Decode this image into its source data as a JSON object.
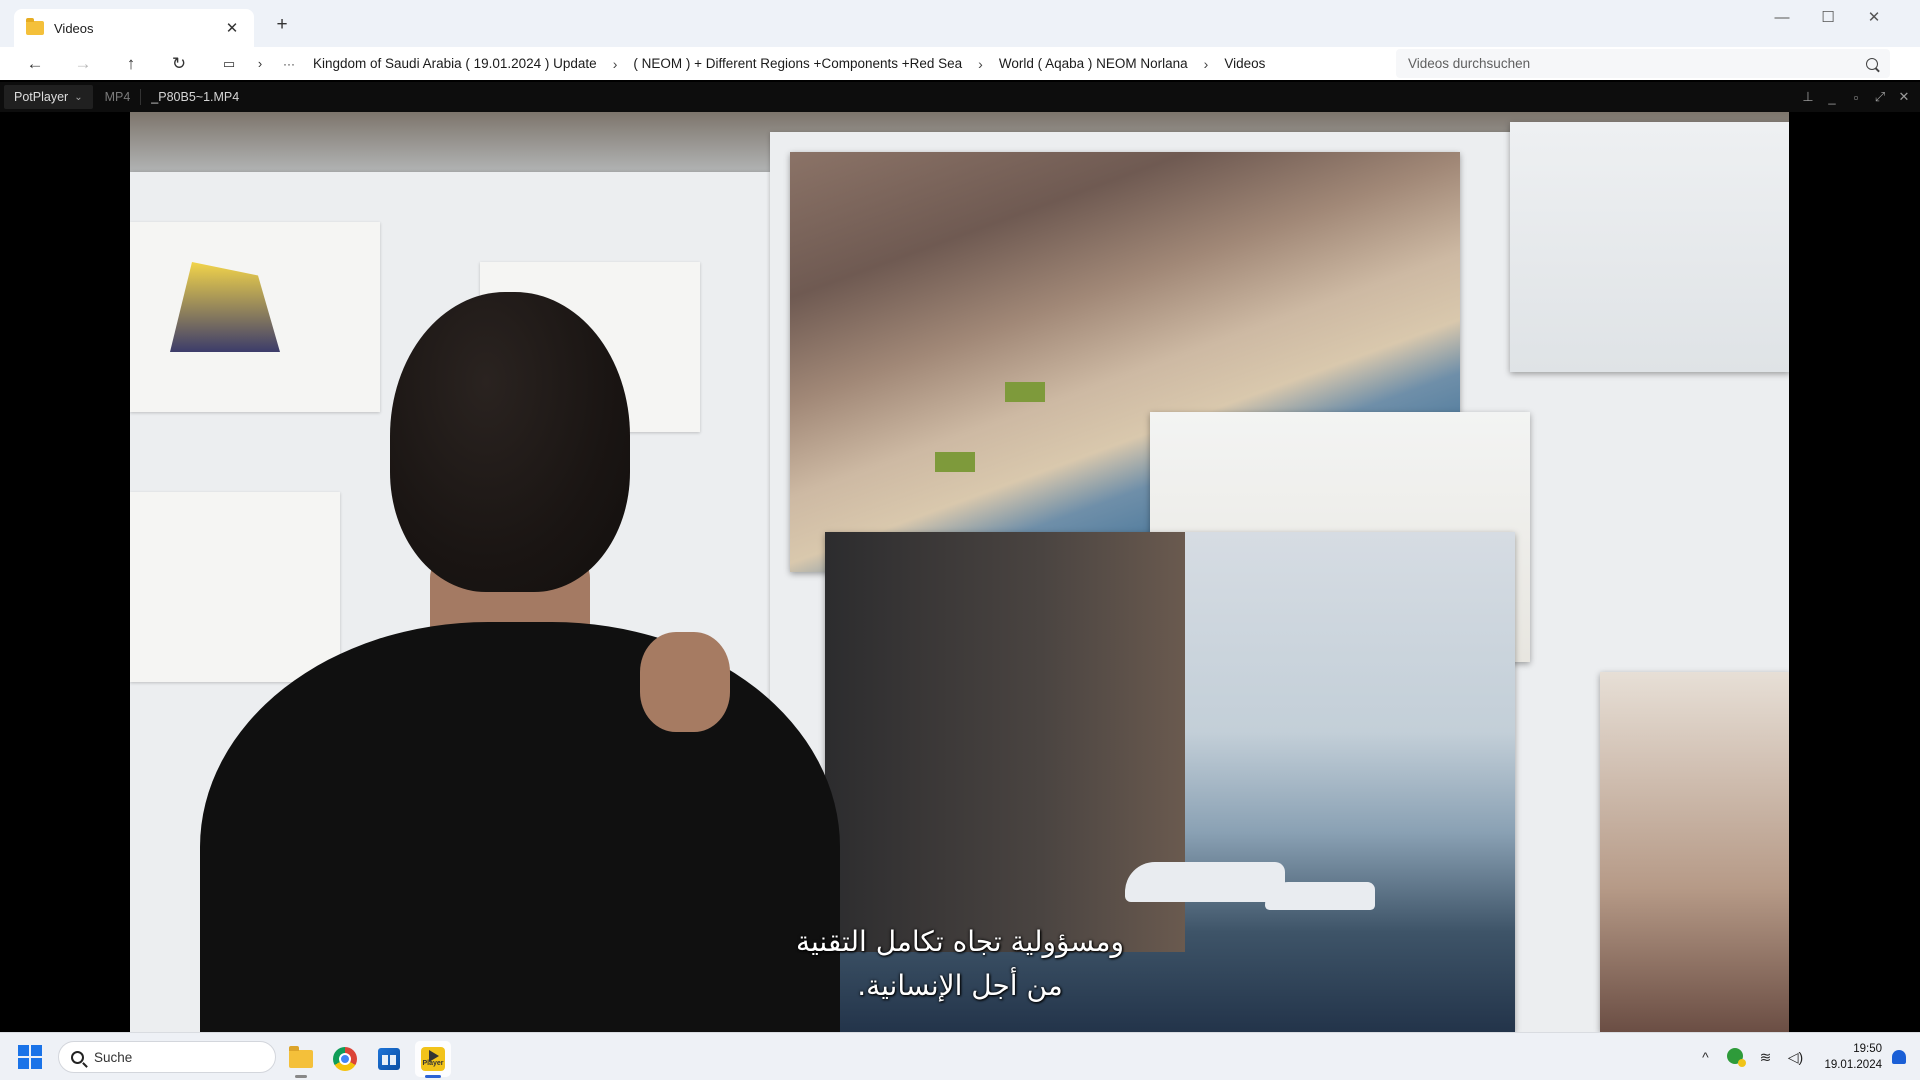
{
  "explorer": {
    "tab_title": "Videos",
    "tab_close": "✕",
    "new_tab": "+",
    "window_controls": {
      "minimize": "—",
      "maximize": "☐",
      "close": "✕"
    },
    "nav": {
      "back": "←",
      "forward": "→",
      "up": "↑",
      "refresh": "↻",
      "more": "···"
    },
    "breadcrumbs": [
      "Kingdom of Saudi Arabia ( 19.01.2024 ) Update",
      "( NEOM ) + Different Regions +Components +Red Sea",
      "World ( Aqaba ) NEOM Norlana",
      "Videos"
    ],
    "search_placeholder": "Videos durchsuchen"
  },
  "potplayer": {
    "menu_label": "PotPlayer",
    "format": "MP4",
    "filename": "_P80B5~1.MP4",
    "subtitle_line1": "ومسؤولية تجاه تكامل التقنية",
    "subtitle_line2": "من أجل الإنسانية."
  },
  "taskbar": {
    "search_placeholder": "Suche",
    "time": "19:50",
    "date": "19.01.2024",
    "apps": [
      "file-explorer",
      "chrome",
      "microsoft-store",
      "potplayer"
    ],
    "potplayer_icon_label": "Player"
  },
  "colors": {
    "accent": "#2c62d4",
    "folder": "#f4c03a",
    "player_bar": "#0d0d0d"
  }
}
